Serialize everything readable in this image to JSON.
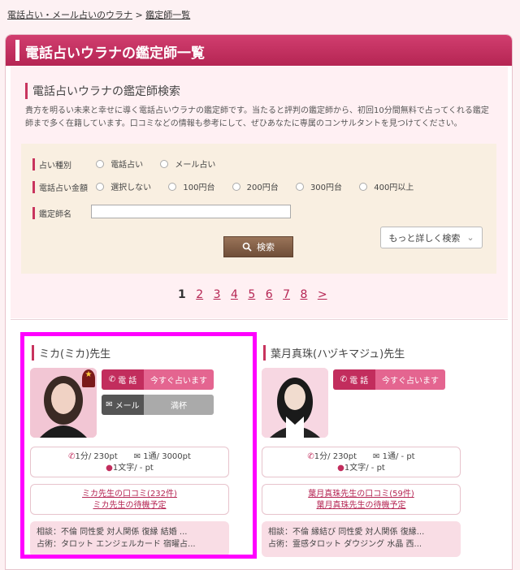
{
  "breadcrumb": {
    "home": "電話占い・メール占いのウラナ",
    "separator": ">",
    "current": "鑑定師一覧"
  },
  "panel": {
    "title": "電話占いウラナの鑑定師一覧"
  },
  "search": {
    "title": "電話占いウラナの鑑定師検索",
    "description": "貴方を明るい未来と幸せに導く電話占いウラナの鑑定師です。当たると評判の鑑定師から、初回10分間無料で占ってくれる鑑定師まで多く在籍しています。口コミなどの情報も参考にして、ぜひあなたに専属のコンサルタントを見つけてください。",
    "type_label": "占い種別",
    "type_options": [
      "電話占い",
      "メール占い"
    ],
    "price_label": "電話占い金額",
    "price_options": [
      "選択しない",
      "100円台",
      "200円台",
      "300円台",
      "400円以上"
    ],
    "name_label": "鑑定師名",
    "name_value": "",
    "search_button": "検索",
    "more_button": "もっと詳しく検索"
  },
  "pagination": {
    "pages": [
      "1",
      "2",
      "3",
      "4",
      "5",
      "6",
      "7",
      "8"
    ],
    "current": "1",
    "next": ">"
  },
  "cards": [
    {
      "name": "ミカ(ミカ)先生",
      "badge": "★",
      "call_label": "電 話",
      "call_action": "今すぐ占います",
      "mail_label": "メール",
      "mail_action": "満杯",
      "price_line1": "1分/ 230pt　　✉ 1通/ 3000pt",
      "price_line2": "1文字/ - pt",
      "review_link": "ミカ先生の口コミ(232件)",
      "schedule_link": "ミカ先生の待機予定",
      "consult": "相談：不倫 同性愛 対人関係 復縁 結婚 ...",
      "method": "占術：タロット エンジェルカード 宿曜占..."
    },
    {
      "name": "葉月真珠(ハヅキマジュ)先生",
      "call_label": "電 話",
      "call_action": "今すぐ占います",
      "price_line1": "1分/ 230pt　　✉ 1通/ - pt",
      "price_line2": "1文字/ - pt",
      "review_link": "葉月真珠先生の口コミ(59件)",
      "schedule_link": "葉月真珠先生の待機予定",
      "consult": "相談：不倫 縁結び 同性愛 対人関係 復縁...",
      "method": "占術：霊感タロット ダウジング 水晶 西..."
    }
  ],
  "colors": {
    "accent": "#c22d5d",
    "highlight": "#ff00ff"
  }
}
